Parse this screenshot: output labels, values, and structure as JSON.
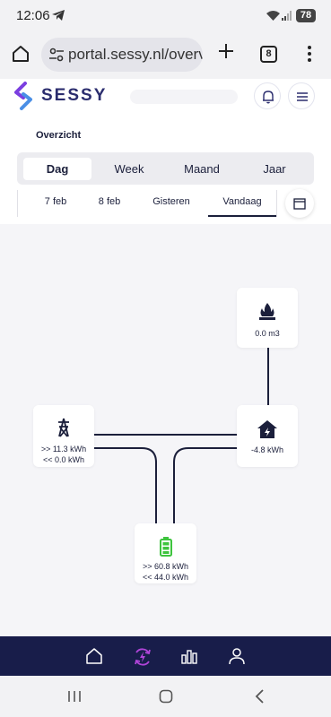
{
  "status": {
    "time": "12:06",
    "battery": "78"
  },
  "browser": {
    "url": "portal.sessy.nl/overv",
    "tab_count": "8"
  },
  "app": {
    "brand": "SESSY"
  },
  "page": {
    "title": "Overzicht"
  },
  "periods": [
    {
      "label": "Dag",
      "active": true
    },
    {
      "label": "Week",
      "active": false
    },
    {
      "label": "Maand",
      "active": false
    },
    {
      "label": "Jaar",
      "active": false
    }
  ],
  "dates": [
    {
      "label": "7 feb",
      "active": false
    },
    {
      "label": "8 feb",
      "active": false
    },
    {
      "label": "Gisteren",
      "active": false
    },
    {
      "label": "Vandaag",
      "active": true
    }
  ],
  "flow": {
    "gas": {
      "value": "0.0 m3",
      "icon": "gas-flame-icon"
    },
    "grid": {
      "import": ">> 11.3 kWh",
      "export": "<< 0.0 kWh",
      "icon": "power-pylon-icon"
    },
    "home": {
      "value": "-4.8 kWh",
      "icon": "home-bolt-icon"
    },
    "battery": {
      "charge": ">> 60.8 kWh",
      "discharge": "<< 44.0 kWh",
      "icon": "battery-icon",
      "color": "#3ec43e"
    }
  },
  "colors": {
    "nav_bg": "#181d4a",
    "accent": "#b044d8",
    "line": "#1b1f3b"
  },
  "nav": [
    {
      "icon": "home-icon",
      "active": false
    },
    {
      "icon": "sync-bolt-icon",
      "active": true
    },
    {
      "icon": "bar-chart-icon",
      "active": false
    },
    {
      "icon": "user-icon",
      "active": false
    }
  ]
}
